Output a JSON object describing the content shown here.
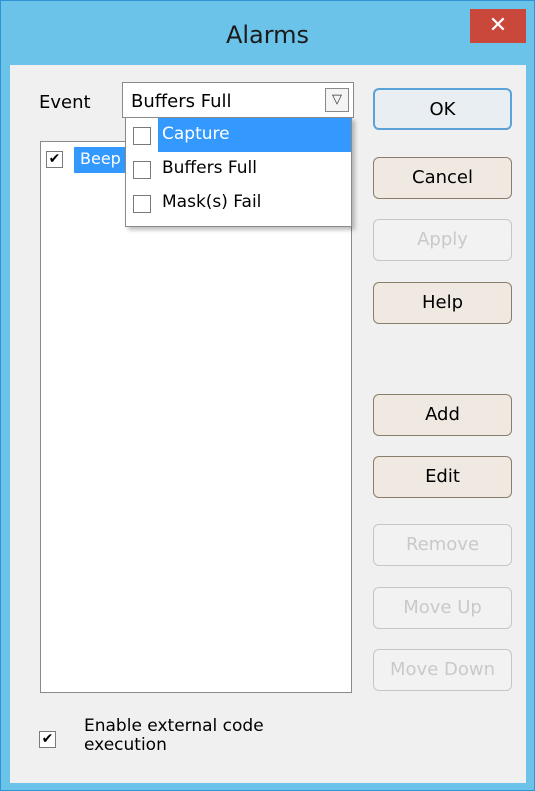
{
  "window": {
    "title": "Alarms",
    "close_label": "✕"
  },
  "event": {
    "label": "Event",
    "selected": "Buffers Full"
  },
  "dropdown": {
    "options": [
      {
        "label": "Capture",
        "checked": false,
        "highlighted": true
      },
      {
        "label": "Buffers Full",
        "checked": false,
        "highlighted": false
      },
      {
        "label": "Mask(s) Fail",
        "checked": false,
        "highlighted": false
      }
    ]
  },
  "list": {
    "items": [
      {
        "label": "Beep",
        "checked": true
      }
    ]
  },
  "options": {
    "enable_external_label": "Enable external code execution",
    "enable_external_checked": true
  },
  "buttons": {
    "ok": "OK",
    "cancel": "Cancel",
    "apply": "Apply",
    "help": "Help",
    "add": "Add",
    "edit": "Edit",
    "remove": "Remove",
    "move_up": "Move Up",
    "move_down": "Move Down"
  },
  "colors": {
    "titlebar": "#6cc3ea",
    "close": "#c9483b",
    "selection": "#3399ff"
  }
}
